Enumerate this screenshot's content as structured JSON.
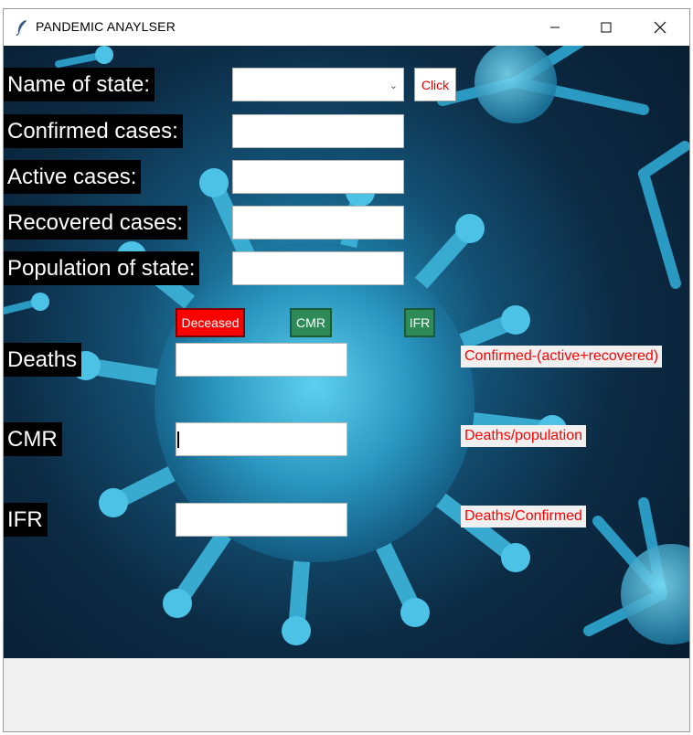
{
  "window": {
    "title": "PANDEMIC ANAYLSER",
    "icon": "feather-icon"
  },
  "form": {
    "state_label": "Name of state:",
    "state_value": "",
    "click_button": "Click",
    "confirmed_label": "Confirmed cases:",
    "active_label": "Active cases:",
    "recovered_label": "Recovered cases:",
    "population_label": "Population of state:",
    "deceased_button": "Deceased",
    "cmr_button": "CMR",
    "ifr_button": "IFR",
    "deaths_label": "Deaths",
    "cmr_label": "CMR",
    "ifr_label": "IFR",
    "deaths_formula": "Confirmed-(active+recovered)",
    "cmr_formula": "Deaths/population",
    "ifr_formula": "Deaths/Confirmed"
  },
  "colors": {
    "accent_red": "#ff0000",
    "button_green": "#2e8b57",
    "label_bg": "#000000"
  }
}
